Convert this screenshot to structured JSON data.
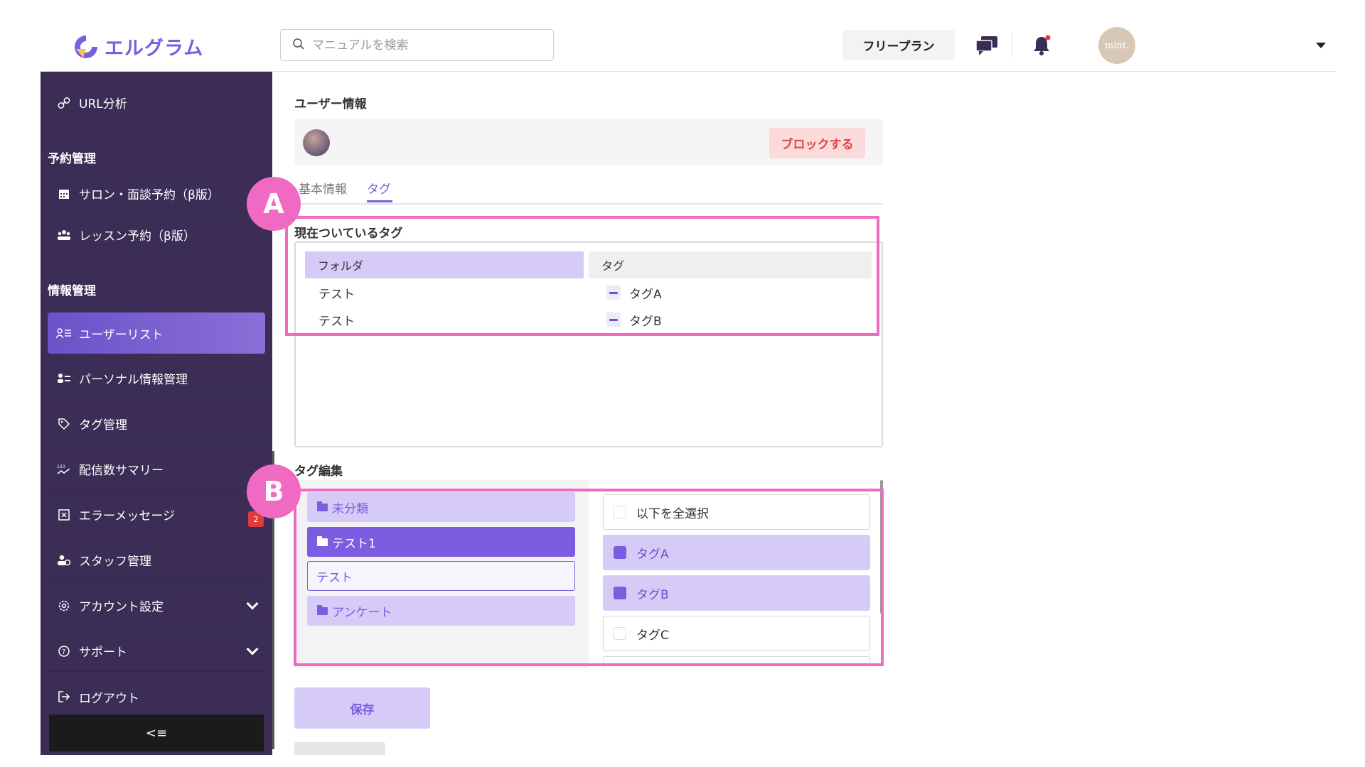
{
  "header": {
    "logo_text": "エルグラム",
    "search_placeholder": "マニュアルを検索",
    "plan_label": "フリープラン",
    "avatar_text": "mint.",
    "icons": [
      "chat-icon",
      "bell-icon",
      "caret-down-icon"
    ],
    "notification_dot_color": "#e23b3b"
  },
  "sidebar": {
    "url_item": "URL分析",
    "section_reservation": "予約管理",
    "salon_item": "サロン・面談予約（β版）",
    "lesson_item": "レッスン予約（β版）",
    "section_info": "情報管理",
    "user_list_item": "ユーザーリスト",
    "personal_item": "パーソナル情報管理",
    "tag_item": "タグ管理",
    "summary_item": "配信数サマリー",
    "error_item": "エラーメッセージ",
    "error_badge": "2",
    "staff_item": "スタッフ管理",
    "account_item": "アカウント設定",
    "support_item": "サポート",
    "logout_item": "ログアウト",
    "collapse_symbol": "<≡"
  },
  "main": {
    "page_title": "ユーザー情報",
    "block_button": "ブロックする",
    "tabs": [
      {
        "label": "基本情報"
      },
      {
        "label": "タグ"
      }
    ],
    "current_tags": {
      "title": "現在ついているタグ",
      "col_folder": "フォルダ",
      "col_tag": "タグ",
      "rows": [
        {
          "folder": "テスト",
          "tag": "タグA"
        },
        {
          "folder": "テスト",
          "tag": "タグB"
        }
      ]
    },
    "tag_edit": {
      "title": "タグ編集",
      "folders": [
        {
          "label": "未分類"
        },
        {
          "label": "テスト1"
        },
        {
          "label": "テスト"
        },
        {
          "label": "アンケート"
        }
      ],
      "select_all": "以下を全選択",
      "options": [
        {
          "label": "タグA",
          "checked": true
        },
        {
          "label": "タグB",
          "checked": true
        },
        {
          "label": "タグC",
          "checked": false
        }
      ]
    },
    "save_button": "保存"
  },
  "annotations": {
    "a_label": "A",
    "b_label": "B",
    "color": "#f06ac4"
  },
  "colors": {
    "accent": "#7c5ce0",
    "sidebar_bg": "#3b2d55",
    "block_text": "#e04444"
  }
}
